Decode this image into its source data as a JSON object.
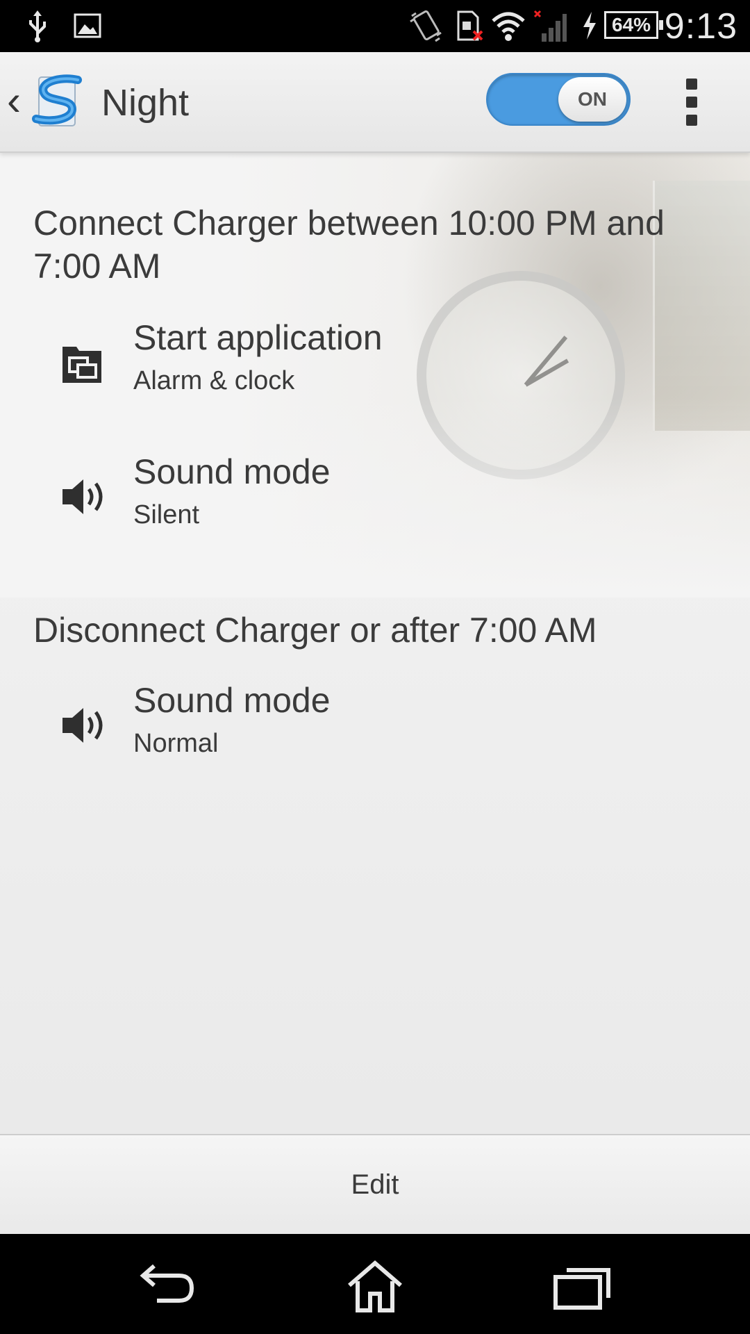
{
  "status_bar": {
    "time": "9:13",
    "battery": "64%",
    "icons": [
      "usb-icon",
      "image-icon",
      "vibrate-icon",
      "sd-card-error-icon",
      "wifi-icon",
      "signal-icon",
      "charging-icon",
      "battery-icon"
    ]
  },
  "action_bar": {
    "title": "Night",
    "toggle_label": "ON",
    "toggle_state": true
  },
  "sections": [
    {
      "heading": "Connect Charger between 10:00 PM and 7:00 AM",
      "items": [
        {
          "title": "Start application",
          "subtitle": "Alarm & clock",
          "icon": "start-application-icon"
        },
        {
          "title": "Sound mode",
          "subtitle": "Silent",
          "icon": "speaker-icon"
        }
      ]
    },
    {
      "heading": "Disconnect Charger or after 7:00 AM",
      "items": [
        {
          "title": "Sound mode",
          "subtitle": "Normal",
          "icon": "speaker-icon"
        }
      ]
    }
  ],
  "footer": {
    "edit_label": "Edit"
  },
  "nav_bar": {
    "icons": [
      "back-icon",
      "home-icon",
      "recent-apps-icon"
    ]
  }
}
